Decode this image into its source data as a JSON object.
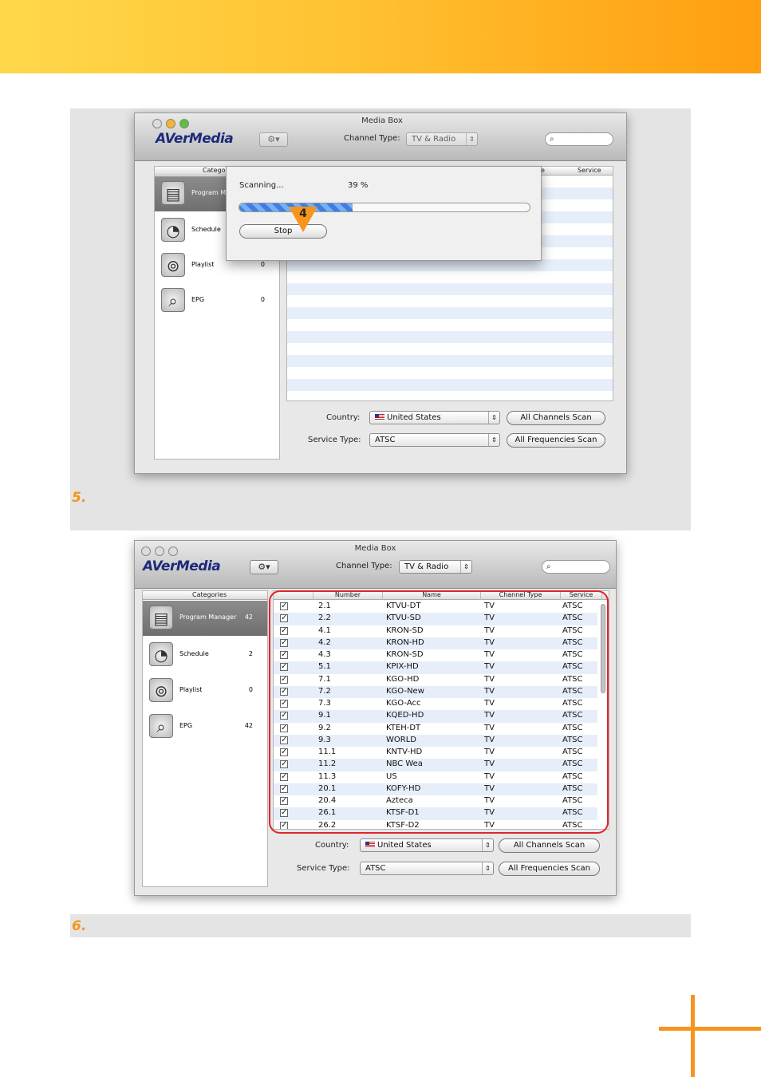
{
  "step5": {
    "number": "5."
  },
  "step6": {
    "number": "6."
  },
  "window1": {
    "title": "Media Box",
    "logo": "AVerMedia",
    "gear": "⚙▾",
    "channel_type_label": "Channel Type:",
    "channel_type_value": "TV & Radio",
    "columns": {
      "categories": "Catego",
      "name_suffix": "e",
      "service": "Service"
    },
    "categories": [
      {
        "label": "Program M",
        "count": ""
      },
      {
        "label": "Schedule",
        "count": ""
      },
      {
        "label": "Playlist",
        "count": "0"
      },
      {
        "label": "EPG",
        "count": "0"
      }
    ],
    "dialog": {
      "scanning_label": "Scanning...",
      "percent": "39 %",
      "progress_fraction": 0.39,
      "stop_label": "Stop"
    },
    "callout_number": "4",
    "country_label": "Country:",
    "country_value": "United States",
    "service_type_label": "Service Type:",
    "service_type_value": "ATSC",
    "all_channels_scan": "All Channels Scan",
    "all_frequencies_scan": "All Frequencies Scan"
  },
  "window2": {
    "title": "Media Box",
    "logo": "AVerMedia",
    "gear": "⚙▾",
    "channel_type_label": "Channel Type:",
    "channel_type_value": "TV & Radio",
    "columns": {
      "categories": "Categories",
      "number": "Number",
      "name": "Name",
      "channel_type": "Channel Type",
      "service": "Service"
    },
    "categories": [
      {
        "label": "Program Manager",
        "count": "42"
      },
      {
        "label": "Schedule",
        "count": "2"
      },
      {
        "label": "Playlist",
        "count": "0"
      },
      {
        "label": "EPG",
        "count": "42"
      }
    ],
    "channels": [
      {
        "checked": "✓",
        "number": "2.1",
        "name": "KTVU-DT",
        "type": "TV",
        "service": "ATSC"
      },
      {
        "checked": "✓",
        "number": "2.2",
        "name": "KTVU-SD",
        "type": "TV",
        "service": "ATSC"
      },
      {
        "checked": "✓",
        "number": "4.1",
        "name": "KRON-SD",
        "type": "TV",
        "service": "ATSC"
      },
      {
        "checked": "✓",
        "number": "4.2",
        "name": "KRON-HD",
        "type": "TV",
        "service": "ATSC"
      },
      {
        "checked": "✓",
        "number": "4.3",
        "name": "KRON-SD",
        "type": "TV",
        "service": "ATSC"
      },
      {
        "checked": "✓",
        "number": "5.1",
        "name": "KPIX-HD",
        "type": "TV",
        "service": "ATSC"
      },
      {
        "checked": "✓",
        "number": "7.1",
        "name": "KGO-HD",
        "type": "TV",
        "service": "ATSC"
      },
      {
        "checked": "✓",
        "number": "7.2",
        "name": "KGO-New",
        "type": "TV",
        "service": "ATSC"
      },
      {
        "checked": "✓",
        "number": "7.3",
        "name": "KGO-Acc",
        "type": "TV",
        "service": "ATSC"
      },
      {
        "checked": "✓",
        "number": "9.1",
        "name": "KQED-HD",
        "type": "TV",
        "service": "ATSC"
      },
      {
        "checked": "✓",
        "number": "9.2",
        "name": "KTEH-DT",
        "type": "TV",
        "service": "ATSC"
      },
      {
        "checked": "✓",
        "number": "9.3",
        "name": "WORLD",
        "type": "TV",
        "service": "ATSC"
      },
      {
        "checked": "✓",
        "number": "11.1",
        "name": "KNTV-HD",
        "type": "TV",
        "service": "ATSC"
      },
      {
        "checked": "✓",
        "number": "11.2",
        "name": "NBC Wea",
        "type": "TV",
        "service": "ATSC"
      },
      {
        "checked": "✓",
        "number": "11.3",
        "name": "US",
        "type": "TV",
        "service": "ATSC"
      },
      {
        "checked": "✓",
        "number": "20.1",
        "name": "KOFY-HD",
        "type": "TV",
        "service": "ATSC"
      },
      {
        "checked": "✓",
        "number": "20.4",
        "name": "Azteca",
        "type": "TV",
        "service": "ATSC"
      },
      {
        "checked": "✓",
        "number": "26.1",
        "name": "KTSF-D1",
        "type": "TV",
        "service": "ATSC"
      },
      {
        "checked": "✓",
        "number": "26.2",
        "name": "KTSF-D2",
        "type": "TV",
        "service": "ATSC"
      }
    ],
    "country_label": "Country:",
    "country_value": "United States",
    "service_type_label": "Service Type:",
    "service_type_value": "ATSC",
    "all_channels_scan": "All Channels Scan",
    "all_frequencies_scan": "All Frequencies Scan"
  },
  "colors": {
    "accent_orange": "#f7941d",
    "highlight_red": "#e0242c",
    "brand_blue": "#1b2a7a"
  }
}
